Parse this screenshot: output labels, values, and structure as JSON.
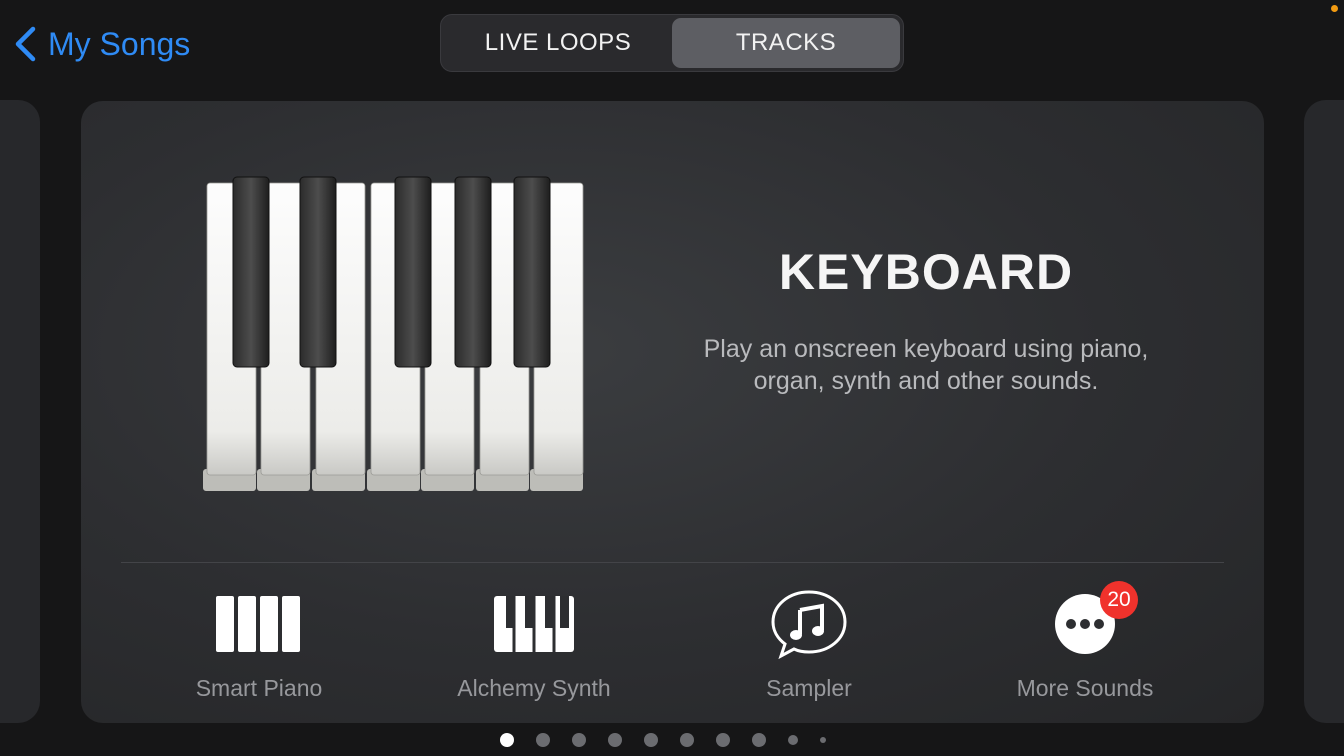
{
  "nav": {
    "back_label": "My Songs"
  },
  "segments": [
    {
      "label": "LIVE LOOPS",
      "selected": false
    },
    {
      "label": "TRACKS",
      "selected": true
    }
  ],
  "instrument": {
    "title": "KEYBOARD",
    "description_line1": "Play an onscreen keyboard using piano,",
    "description_line2": "organ, synth and other sounds.",
    "image_icon": "piano-keys-icon"
  },
  "options": [
    {
      "label": "Smart Piano",
      "icon": "smart-piano-icon"
    },
    {
      "label": "Alchemy Synth",
      "icon": "synth-keys-icon"
    },
    {
      "label": "Sampler",
      "icon": "music-note-bubble-icon"
    },
    {
      "label": "More Sounds",
      "icon": "ellipsis-circle-icon",
      "badge": "20"
    }
  ],
  "pager": {
    "total": 10,
    "current": 1
  },
  "colors": {
    "accent": "#2f8bf5",
    "badge": "#f0322c",
    "status_dot": "#f29b12"
  }
}
